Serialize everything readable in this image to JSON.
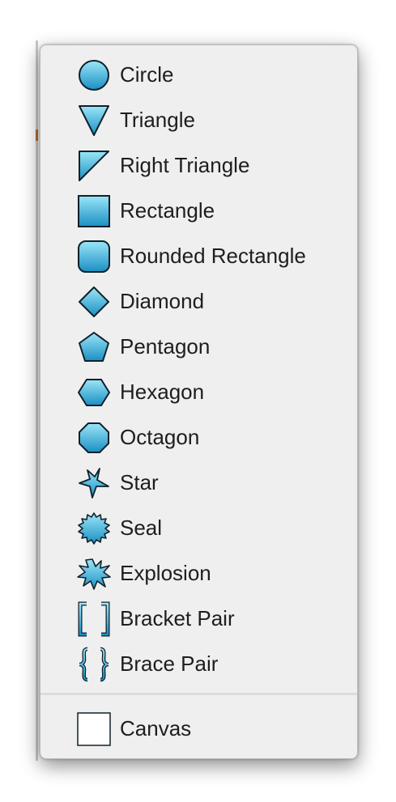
{
  "menu": {
    "items": [
      {
        "label": "Circle",
        "icon": "circle-icon"
      },
      {
        "label": "Triangle",
        "icon": "triangle-icon"
      },
      {
        "label": "Right Triangle",
        "icon": "right-triangle-icon"
      },
      {
        "label": "Rectangle",
        "icon": "rectangle-icon"
      },
      {
        "label": "Rounded Rectangle",
        "icon": "rounded-rectangle-icon"
      },
      {
        "label": "Diamond",
        "icon": "diamond-icon"
      },
      {
        "label": "Pentagon",
        "icon": "pentagon-icon"
      },
      {
        "label": "Hexagon",
        "icon": "hexagon-icon"
      },
      {
        "label": "Octagon",
        "icon": "octagon-icon"
      },
      {
        "label": "Star",
        "icon": "star-icon"
      },
      {
        "label": "Seal",
        "icon": "seal-icon"
      },
      {
        "label": "Explosion",
        "icon": "explosion-icon"
      },
      {
        "label": "Bracket Pair",
        "icon": "bracket-pair-icon"
      },
      {
        "label": "Brace Pair",
        "icon": "brace-pair-icon"
      }
    ],
    "footer_item": {
      "label": "Canvas",
      "icon": "canvas-icon"
    }
  },
  "colors": {
    "shape_fill_top": "#8fe0f5",
    "shape_fill_bottom": "#1c93c6",
    "shape_stroke": "#10202a",
    "menu_background": "#efefef",
    "text": "#1e1e1e"
  }
}
